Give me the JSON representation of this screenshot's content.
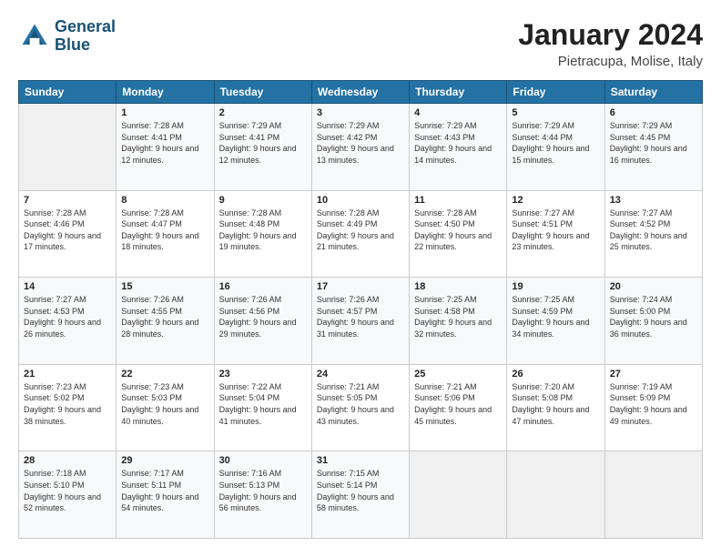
{
  "logo": {
    "line1": "General",
    "line2": "Blue"
  },
  "header": {
    "month": "January 2024",
    "location": "Pietracupa, Molise, Italy"
  },
  "weekdays": [
    "Sunday",
    "Monday",
    "Tuesday",
    "Wednesday",
    "Thursday",
    "Friday",
    "Saturday"
  ],
  "weeks": [
    [
      {
        "day": "",
        "sunrise": "",
        "sunset": "",
        "daylight": ""
      },
      {
        "day": "1",
        "sunrise": "Sunrise: 7:28 AM",
        "sunset": "Sunset: 4:41 PM",
        "daylight": "Daylight: 9 hours and 12 minutes."
      },
      {
        "day": "2",
        "sunrise": "Sunrise: 7:29 AM",
        "sunset": "Sunset: 4:41 PM",
        "daylight": "Daylight: 9 hours and 12 minutes."
      },
      {
        "day": "3",
        "sunrise": "Sunrise: 7:29 AM",
        "sunset": "Sunset: 4:42 PM",
        "daylight": "Daylight: 9 hours and 13 minutes."
      },
      {
        "day": "4",
        "sunrise": "Sunrise: 7:29 AM",
        "sunset": "Sunset: 4:43 PM",
        "daylight": "Daylight: 9 hours and 14 minutes."
      },
      {
        "day": "5",
        "sunrise": "Sunrise: 7:29 AM",
        "sunset": "Sunset: 4:44 PM",
        "daylight": "Daylight: 9 hours and 15 minutes."
      },
      {
        "day": "6",
        "sunrise": "Sunrise: 7:29 AM",
        "sunset": "Sunset: 4:45 PM",
        "daylight": "Daylight: 9 hours and 16 minutes."
      }
    ],
    [
      {
        "day": "7",
        "sunrise": "Sunrise: 7:28 AM",
        "sunset": "Sunset: 4:46 PM",
        "daylight": "Daylight: 9 hours and 17 minutes."
      },
      {
        "day": "8",
        "sunrise": "Sunrise: 7:28 AM",
        "sunset": "Sunset: 4:47 PM",
        "daylight": "Daylight: 9 hours and 18 minutes."
      },
      {
        "day": "9",
        "sunrise": "Sunrise: 7:28 AM",
        "sunset": "Sunset: 4:48 PM",
        "daylight": "Daylight: 9 hours and 19 minutes."
      },
      {
        "day": "10",
        "sunrise": "Sunrise: 7:28 AM",
        "sunset": "Sunset: 4:49 PM",
        "daylight": "Daylight: 9 hours and 21 minutes."
      },
      {
        "day": "11",
        "sunrise": "Sunrise: 7:28 AM",
        "sunset": "Sunset: 4:50 PM",
        "daylight": "Daylight: 9 hours and 22 minutes."
      },
      {
        "day": "12",
        "sunrise": "Sunrise: 7:27 AM",
        "sunset": "Sunset: 4:51 PM",
        "daylight": "Daylight: 9 hours and 23 minutes."
      },
      {
        "day": "13",
        "sunrise": "Sunrise: 7:27 AM",
        "sunset": "Sunset: 4:52 PM",
        "daylight": "Daylight: 9 hours and 25 minutes."
      }
    ],
    [
      {
        "day": "14",
        "sunrise": "Sunrise: 7:27 AM",
        "sunset": "Sunset: 4:53 PM",
        "daylight": "Daylight: 9 hours and 26 minutes."
      },
      {
        "day": "15",
        "sunrise": "Sunrise: 7:26 AM",
        "sunset": "Sunset: 4:55 PM",
        "daylight": "Daylight: 9 hours and 28 minutes."
      },
      {
        "day": "16",
        "sunrise": "Sunrise: 7:26 AM",
        "sunset": "Sunset: 4:56 PM",
        "daylight": "Daylight: 9 hours and 29 minutes."
      },
      {
        "day": "17",
        "sunrise": "Sunrise: 7:26 AM",
        "sunset": "Sunset: 4:57 PM",
        "daylight": "Daylight: 9 hours and 31 minutes."
      },
      {
        "day": "18",
        "sunrise": "Sunrise: 7:25 AM",
        "sunset": "Sunset: 4:58 PM",
        "daylight": "Daylight: 9 hours and 32 minutes."
      },
      {
        "day": "19",
        "sunrise": "Sunrise: 7:25 AM",
        "sunset": "Sunset: 4:59 PM",
        "daylight": "Daylight: 9 hours and 34 minutes."
      },
      {
        "day": "20",
        "sunrise": "Sunrise: 7:24 AM",
        "sunset": "Sunset: 5:00 PM",
        "daylight": "Daylight: 9 hours and 36 minutes."
      }
    ],
    [
      {
        "day": "21",
        "sunrise": "Sunrise: 7:23 AM",
        "sunset": "Sunset: 5:02 PM",
        "daylight": "Daylight: 9 hours and 38 minutes."
      },
      {
        "day": "22",
        "sunrise": "Sunrise: 7:23 AM",
        "sunset": "Sunset: 5:03 PM",
        "daylight": "Daylight: 9 hours and 40 minutes."
      },
      {
        "day": "23",
        "sunrise": "Sunrise: 7:22 AM",
        "sunset": "Sunset: 5:04 PM",
        "daylight": "Daylight: 9 hours and 41 minutes."
      },
      {
        "day": "24",
        "sunrise": "Sunrise: 7:21 AM",
        "sunset": "Sunset: 5:05 PM",
        "daylight": "Daylight: 9 hours and 43 minutes."
      },
      {
        "day": "25",
        "sunrise": "Sunrise: 7:21 AM",
        "sunset": "Sunset: 5:06 PM",
        "daylight": "Daylight: 9 hours and 45 minutes."
      },
      {
        "day": "26",
        "sunrise": "Sunrise: 7:20 AM",
        "sunset": "Sunset: 5:08 PM",
        "daylight": "Daylight: 9 hours and 47 minutes."
      },
      {
        "day": "27",
        "sunrise": "Sunrise: 7:19 AM",
        "sunset": "Sunset: 5:09 PM",
        "daylight": "Daylight: 9 hours and 49 minutes."
      }
    ],
    [
      {
        "day": "28",
        "sunrise": "Sunrise: 7:18 AM",
        "sunset": "Sunset: 5:10 PM",
        "daylight": "Daylight: 9 hours and 52 minutes."
      },
      {
        "day": "29",
        "sunrise": "Sunrise: 7:17 AM",
        "sunset": "Sunset: 5:11 PM",
        "daylight": "Daylight: 9 hours and 54 minutes."
      },
      {
        "day": "30",
        "sunrise": "Sunrise: 7:16 AM",
        "sunset": "Sunset: 5:13 PM",
        "daylight": "Daylight: 9 hours and 56 minutes."
      },
      {
        "day": "31",
        "sunrise": "Sunrise: 7:15 AM",
        "sunset": "Sunset: 5:14 PM",
        "daylight": "Daylight: 9 hours and 58 minutes."
      },
      {
        "day": "",
        "sunrise": "",
        "sunset": "",
        "daylight": ""
      },
      {
        "day": "",
        "sunrise": "",
        "sunset": "",
        "daylight": ""
      },
      {
        "day": "",
        "sunrise": "",
        "sunset": "",
        "daylight": ""
      }
    ]
  ]
}
